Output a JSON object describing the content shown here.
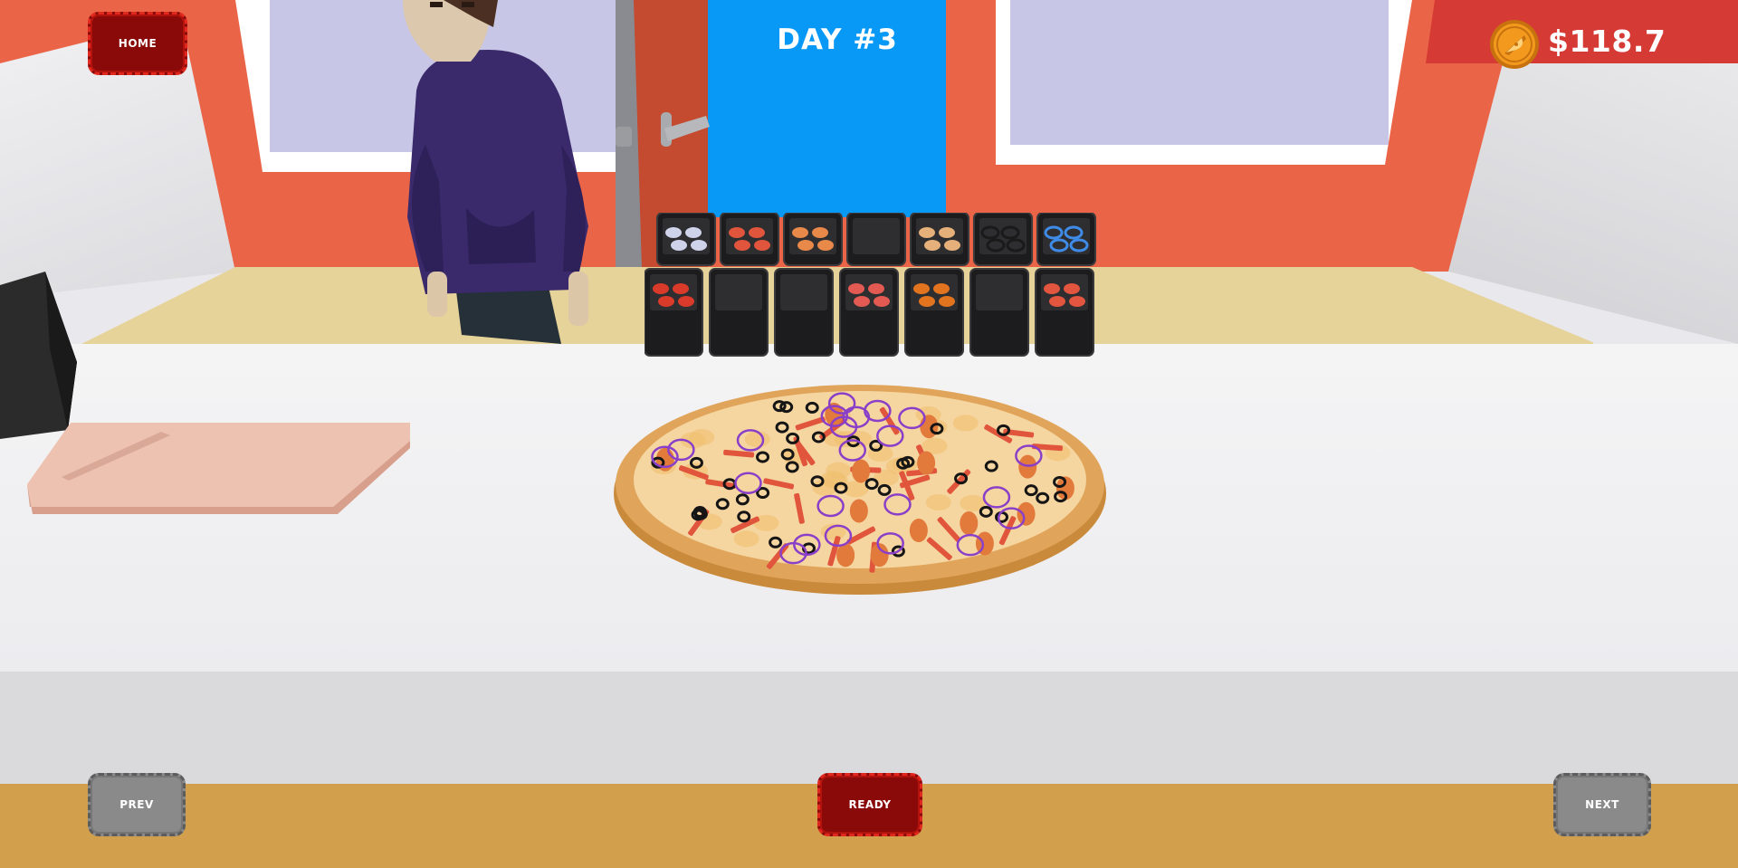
{
  "hud": {
    "home_label": "HOME",
    "day_label": "DAY #3",
    "money": "$118.7",
    "prev_label": "PREV",
    "ready_label": "READY",
    "next_label": "NEXT"
  },
  "icons": {
    "coin": "pizza-coin-icon"
  },
  "colors": {
    "wall": "#ea6447",
    "door_opening": "#0899f6",
    "counter": "#f4f4f5",
    "floor": "#d29f4c",
    "button_red": "#8a0a0a",
    "button_gray": "#8a8a8a",
    "coin": "#f39a1e"
  },
  "toppings": {
    "top_row": [
      "anchovies",
      "bacon",
      "shrimp",
      "empty",
      "chicken",
      "black-olives",
      "onion-rings"
    ],
    "bottom_row": [
      "peppers",
      "empty",
      "empty",
      "pepperoni",
      "orange-slices",
      "empty",
      "tomato-slices"
    ]
  }
}
